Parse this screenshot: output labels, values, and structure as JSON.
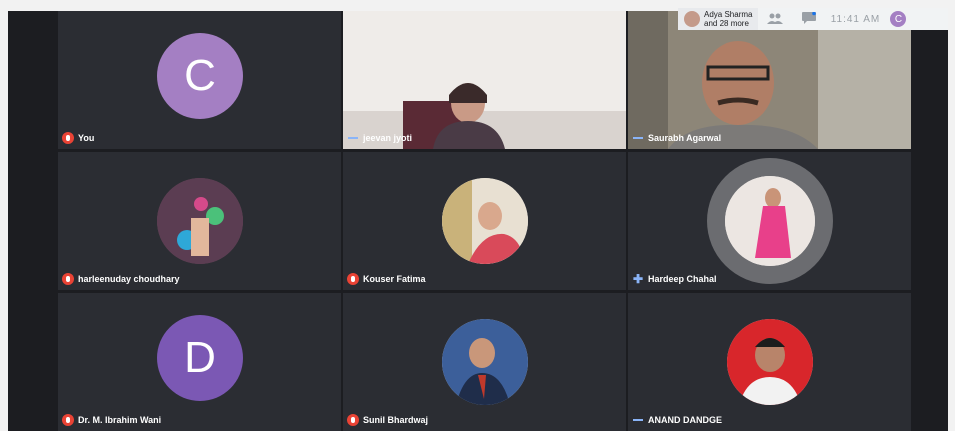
{
  "topbar": {
    "participants_chip": "Adya Sharma\nand 28 more",
    "time": "11:41 AM",
    "self_initial": "C",
    "icons": [
      "people-icon",
      "chat-icon"
    ]
  },
  "tiles": [
    {
      "name": "You",
      "kind": "letter",
      "letter": "C",
      "mic": "muted",
      "color": "#a47fc3"
    },
    {
      "name": "jeevan jyoti",
      "kind": "video",
      "mic": "talking"
    },
    {
      "name": "Saurabh Agarwal",
      "kind": "video",
      "mic": "talking"
    },
    {
      "name": "harleenuday choudhary",
      "kind": "photo",
      "mic": "muted"
    },
    {
      "name": "Kouser Fatima",
      "kind": "photo",
      "mic": "muted"
    },
    {
      "name": "Hardeep Chahal",
      "kind": "photo",
      "mic": "talking-plus",
      "speaking": true
    },
    {
      "name": "Dr. M. Ibrahim Wani",
      "kind": "letter",
      "letter": "D",
      "mic": "muted",
      "color": "#7b58b4"
    },
    {
      "name": "Sunil Bhardwaj",
      "kind": "photo",
      "mic": "muted"
    },
    {
      "name": "ANAND DANDGE",
      "kind": "photo",
      "mic": "talking"
    }
  ]
}
